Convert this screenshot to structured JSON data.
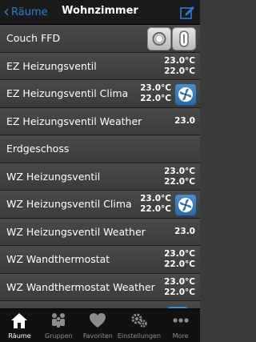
{
  "nav": {
    "back_label": "Räume",
    "title": "Wohnzimmer"
  },
  "rows": [
    {
      "label": "Couch FFD"
    },
    {
      "label": "EZ Heizungsventil",
      "v1": "23.0°C",
      "v2": "22.0°C"
    },
    {
      "label": "EZ Heizungsventil Clima",
      "v1": "23.0°C",
      "v2": "22.0°C"
    },
    {
      "label": "EZ Heizungsventil Weather",
      "v1": "23.0"
    },
    {
      "label": "Erdgeschoss"
    },
    {
      "label": "WZ Heizungsventil",
      "v1": "23.0°C",
      "v2": "22.0°C"
    },
    {
      "label": "WZ Heizungsventil Clima",
      "v1": "23.0°C",
      "v2": "22.0°C"
    },
    {
      "label": "WZ Heizungsventil Weather",
      "v1": "23.0"
    },
    {
      "label": "WZ Wandthermostat",
      "v1": "23.0°C",
      "v2": "22.0°C"
    },
    {
      "label": "WZ Wandthermostat Weather",
      "v1": "23.0°C",
      "v2": "22.0°C"
    }
  ],
  "tabs": [
    "Räume",
    "Gruppen",
    "Favoriten",
    "Einstellungen",
    "More"
  ],
  "colors": {
    "accent": "#2f7bd8",
    "nav_bg": "#1a1a1a",
    "row_bg": "#444444",
    "tab_bg": "#111111"
  },
  "icons": {
    "back": "chevron-left-icon",
    "edit": "edit-icon",
    "ctrl1": "circle-button-icon",
    "ctrl2": "toggle-button-icon",
    "fan": "fan-icon",
    "tabs": [
      "home-icon",
      "group-icon",
      "heart-icon",
      "gear-icon",
      "more-icon"
    ]
  }
}
